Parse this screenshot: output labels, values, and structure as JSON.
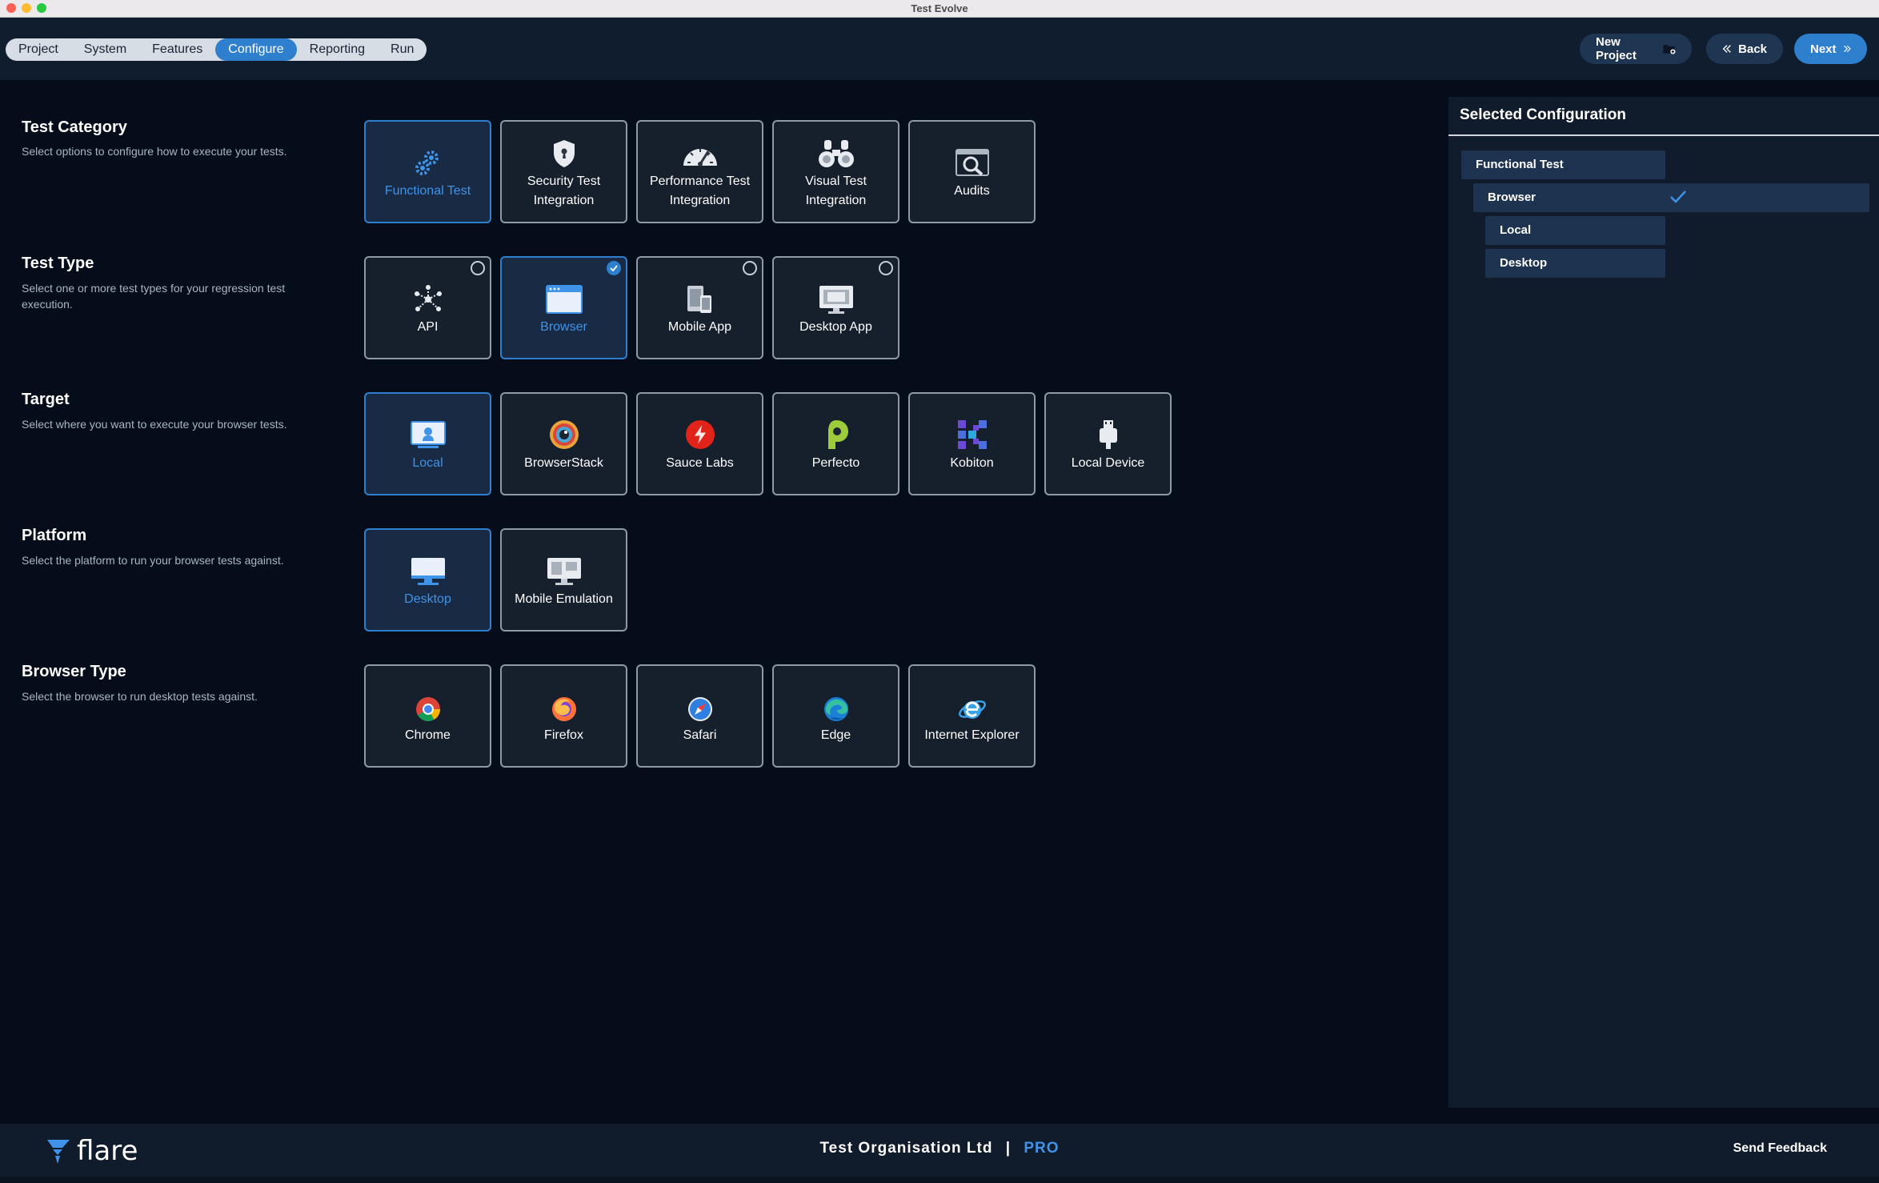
{
  "window": {
    "title": "Test Evolve"
  },
  "nav": {
    "tabs": [
      {
        "label": "Project",
        "active": false
      },
      {
        "label": "System",
        "active": false
      },
      {
        "label": "Features",
        "active": false
      },
      {
        "label": "Configure",
        "active": true
      },
      {
        "label": "Reporting",
        "active": false
      },
      {
        "label": "Run",
        "active": false
      }
    ],
    "new_project_label": "New Project",
    "back_label": "Back",
    "next_label": "Next"
  },
  "sections": {
    "test_category": {
      "title": "Test Category",
      "desc": "Select options to configure how to execute your tests.",
      "options": [
        {
          "label": "Functional Test",
          "selected": true
        },
        {
          "label": "Security Test Integration",
          "selected": false
        },
        {
          "label": "Performance Test Integration",
          "selected": false
        },
        {
          "label": "Visual Test Integration",
          "selected": false
        },
        {
          "label": "Audits",
          "selected": false
        }
      ]
    },
    "test_type": {
      "title": "Test Type",
      "desc": "Select one or more test types for your regression test execution.",
      "options": [
        {
          "label": "API",
          "selected": false
        },
        {
          "label": "Browser",
          "selected": true
        },
        {
          "label": "Mobile App",
          "selected": false
        },
        {
          "label": "Desktop App",
          "selected": false
        }
      ]
    },
    "target": {
      "title": "Target",
      "desc": "Select where you want to execute your browser tests.",
      "options": [
        {
          "label": "Local",
          "selected": true
        },
        {
          "label": "BrowserStack",
          "selected": false
        },
        {
          "label": "Sauce Labs",
          "selected": false
        },
        {
          "label": "Perfecto",
          "selected": false
        },
        {
          "label": "Kobiton",
          "selected": false
        },
        {
          "label": "Local Device",
          "selected": false
        }
      ]
    },
    "platform": {
      "title": "Platform",
      "desc": "Select the platform to run your browser tests against.",
      "options": [
        {
          "label": "Desktop",
          "selected": true
        },
        {
          "label": "Mobile Emulation",
          "selected": false
        }
      ]
    },
    "browser_type": {
      "title": "Browser Type",
      "desc": "Select the browser to run desktop tests against.",
      "options": [
        {
          "label": "Chrome",
          "selected": false
        },
        {
          "label": "Firefox",
          "selected": false
        },
        {
          "label": "Safari",
          "selected": false
        },
        {
          "label": "Edge",
          "selected": false
        },
        {
          "label": "Internet Explorer",
          "selected": false
        }
      ]
    }
  },
  "selected_configuration": {
    "title": "Selected Configuration",
    "items": [
      "Functional Test",
      "Browser",
      "Local",
      "Desktop"
    ]
  },
  "footer": {
    "logo_text": "flare",
    "org": "Test Organisation Ltd",
    "separator": "|",
    "tier": "PRO",
    "feedback": "Send Feedback"
  },
  "colors": {
    "accent": "#2f7fcf",
    "background": "#050d1a",
    "panel": "#101b2b"
  }
}
